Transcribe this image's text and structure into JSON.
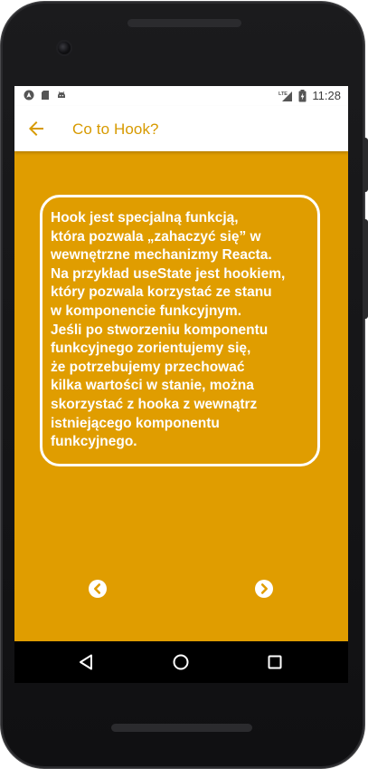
{
  "status_bar": {
    "left_icons": [
      "android-auto-icon",
      "sd-card-icon",
      "android-robot-icon"
    ],
    "right_icons": [
      "signal-lte-icon",
      "battery-charging-icon"
    ],
    "time": "11:28"
  },
  "app_bar": {
    "title": "Co to Hook?",
    "back_icon": "arrow-back-icon"
  },
  "content": {
    "card_text": "Hook jest specjalną funkcją,\nktóra pozwala „zahaczyć się” w\nwewnętrzne mechanizmy Reacta.\nNa przykład useState jest hookiem,\nktóry pozwala korzystać ze stanu\nw komponencie funkcyjnym.\nJeśli po stworzeniu komponentu\nfunkcyjnego zorientujemy się,\nże potrzebujemy przechować\nkilka wartości w stanie, można\nskorzystać z hooka z wewnątrz\nistniejącego komponentu\nfunkcyjnego.",
    "prev_icon": "chevron-left-circle-icon",
    "next_icon": "chevron-right-circle-icon"
  },
  "system_nav": {
    "icons": [
      "nav-back-triangle-icon",
      "nav-home-circle-icon",
      "nav-recents-square-icon"
    ]
  },
  "colors": {
    "background": "#e09d00",
    "accent": "#d79a00",
    "text_on_background": "#ffffff"
  }
}
